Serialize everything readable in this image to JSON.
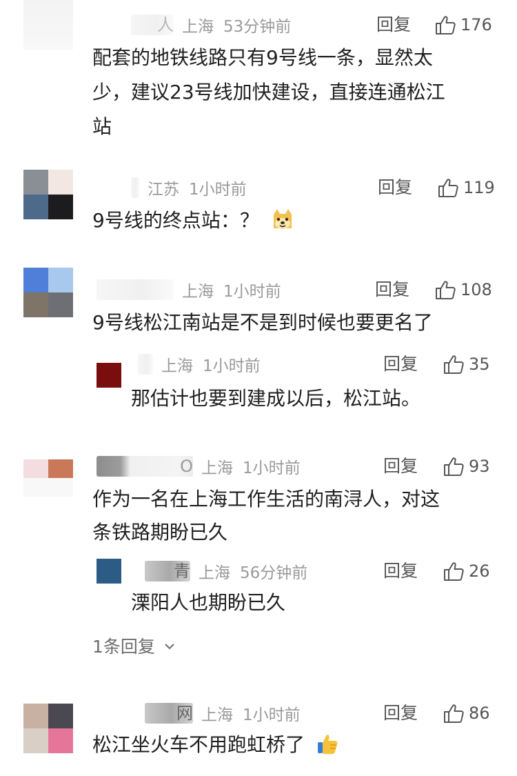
{
  "comments": [
    {
      "name": "人",
      "location": "上海",
      "time": "53分钟前",
      "reply_label": "回复",
      "likes": "176",
      "lines": [
        "配套的地铁线路只有9号线一条，显然太",
        "少，建议23号线加快建设，直接连通松江",
        "站"
      ]
    },
    {
      "name": "",
      "location": "江苏",
      "time": "1小时前",
      "reply_label": "回复",
      "likes": "119",
      "lines": [
        "9号线的终点站：？"
      ],
      "emoji": "doge-emoji"
    },
    {
      "name": "",
      "location": "上海",
      "time": "1小时前",
      "reply_label": "回复",
      "likes": "108",
      "lines": [
        "9号线松江南站是不是到时候也要更名了"
      ],
      "replies": [
        {
          "name": "",
          "location": "上海",
          "time": "1小时前",
          "reply_label": "回复",
          "likes": "35",
          "lines": [
            "那估计也要到建成以后，松江站。"
          ]
        }
      ]
    },
    {
      "name": "O",
      "location": "上海",
      "time": "1小时前",
      "reply_label": "回复",
      "likes": "93",
      "lines": [
        "作为一名在上海工作生活的南浔人，对这",
        "条铁路期盼已久"
      ],
      "replies": [
        {
          "name": "青",
          "location": "上海",
          "time": "56分钟前",
          "reply_label": "回复",
          "likes": "26",
          "lines": [
            "溧阳人也期盼已久"
          ]
        }
      ],
      "more_replies": "1条回复"
    },
    {
      "name": "网",
      "location": "上海",
      "time": "1小时前",
      "reply_label": "回复",
      "likes": "86",
      "lines": [
        "松江坐火车不用跑虹桥了"
      ],
      "emoji": "thumbs-up-emoji"
    }
  ],
  "colors": {
    "text": "#1f1f1f",
    "meta": "#9a9a9a",
    "action": "#555555"
  }
}
